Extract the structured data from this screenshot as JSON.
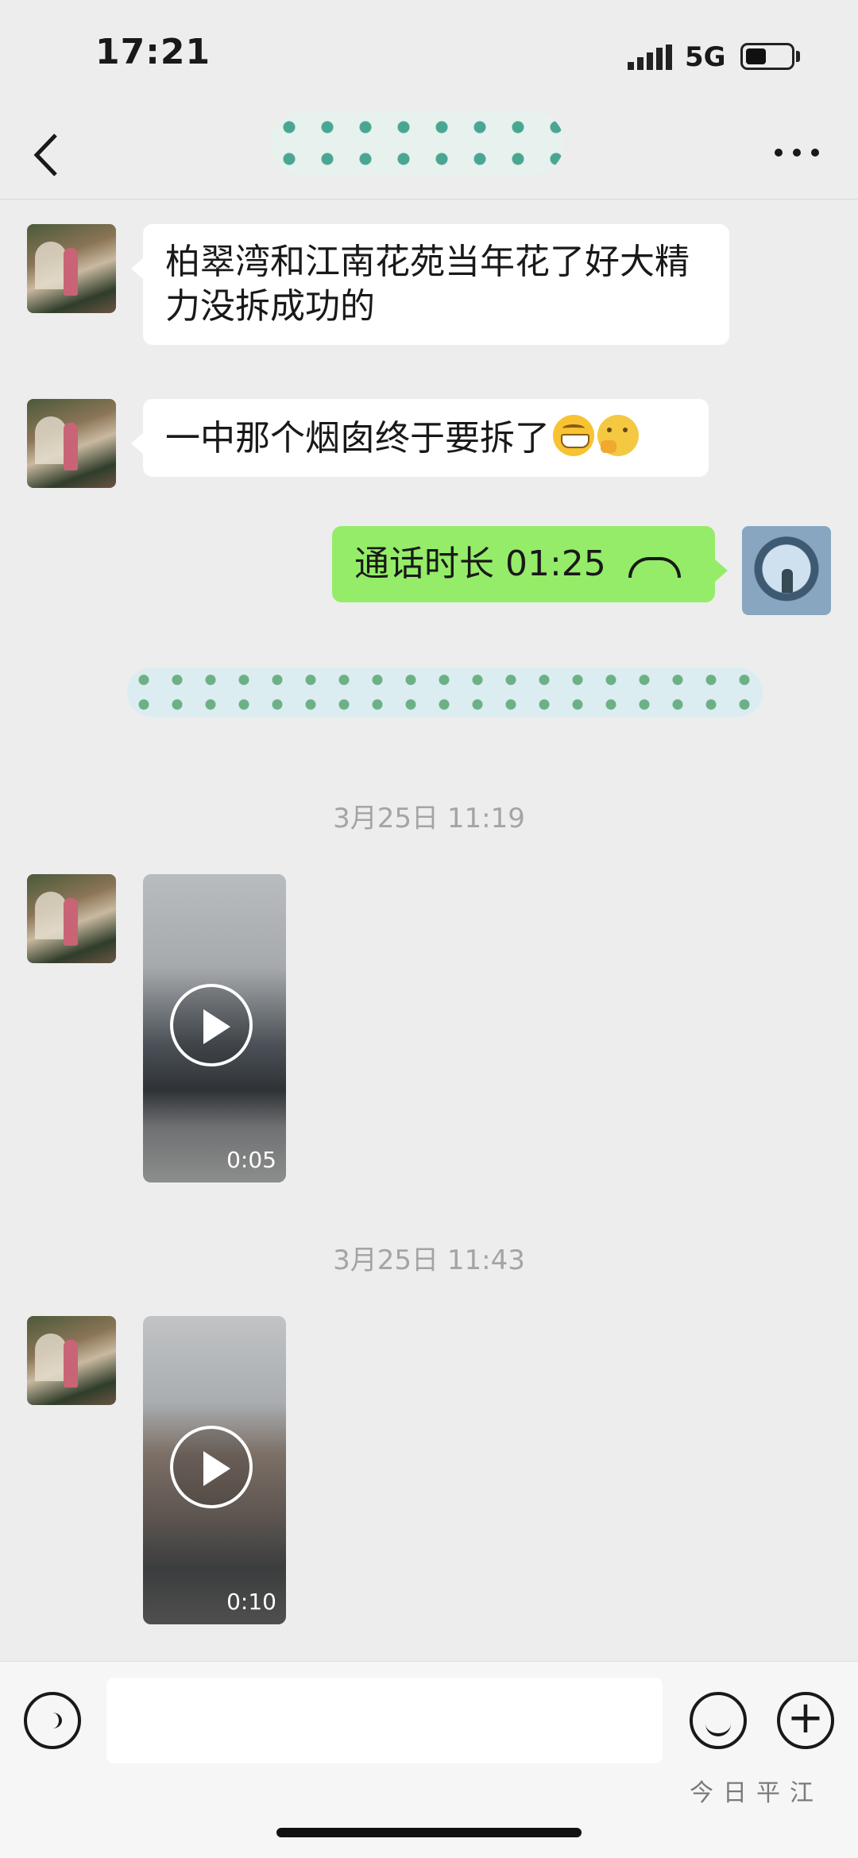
{
  "status_bar": {
    "time": "17:21",
    "network": "5G"
  },
  "header": {
    "title": ""
  },
  "messages": [
    {
      "from": "other",
      "text": "柏翠湾和江南花苑当年花了好大精力没拆成功的"
    },
    {
      "from": "other",
      "text": "一中那个烟囱终于要拆了"
    },
    {
      "from": "me",
      "type": "call",
      "text": "通话时长 01:25"
    }
  ],
  "timestamps": [
    "3月25日 11:19",
    "3月25日 11:43"
  ],
  "videos": [
    {
      "duration": "0:05"
    },
    {
      "duration": "0:10"
    }
  ],
  "watermark": "今日平江",
  "icons": {
    "back": "chevron-left-icon",
    "more": "more-dots-icon",
    "voice": "voice-icon",
    "emoji": "emoji-icon",
    "plus": "plus-icon",
    "play": "play-icon",
    "hangup": "phone-hangup-icon"
  },
  "colors": {
    "background": "#ededed",
    "my_bubble": "#95ec69",
    "other_bubble": "#ffffff"
  }
}
